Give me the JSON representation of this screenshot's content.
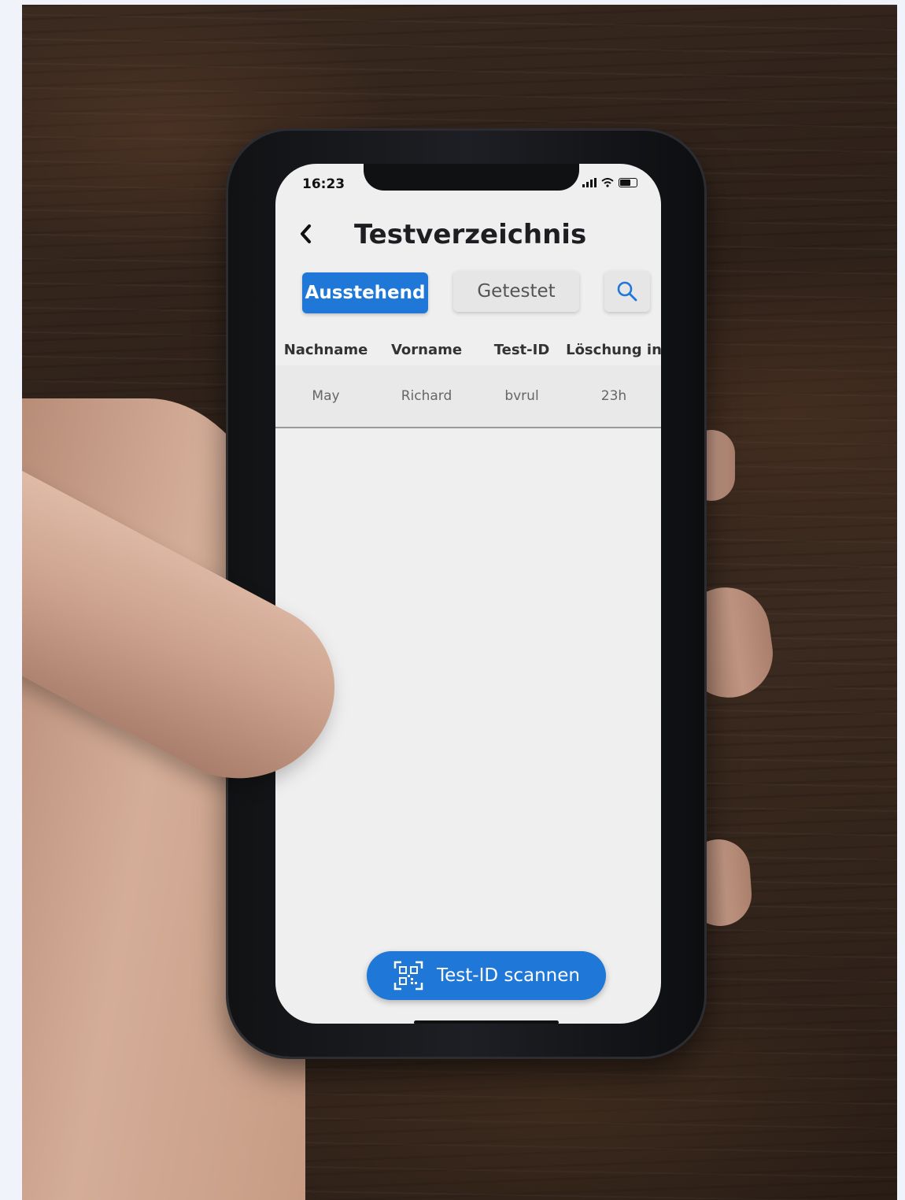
{
  "status_bar": {
    "time": "16:23"
  },
  "header": {
    "back_icon": "chevron-left-icon",
    "title": "Testverzeichnis"
  },
  "tabs": {
    "active": "Ausstehend",
    "inactive": "Getestet",
    "search_icon": "search-icon"
  },
  "table": {
    "headers": [
      "Nachname",
      "Vorname",
      "Test-ID",
      "Löschung in"
    ],
    "rows": [
      [
        "May",
        "Richard",
        "bvrul",
        "23h"
      ]
    ]
  },
  "fab": {
    "label": "Test-ID scannen",
    "icon": "qr-code-icon"
  },
  "colors": {
    "accent": "#1f78d8"
  }
}
